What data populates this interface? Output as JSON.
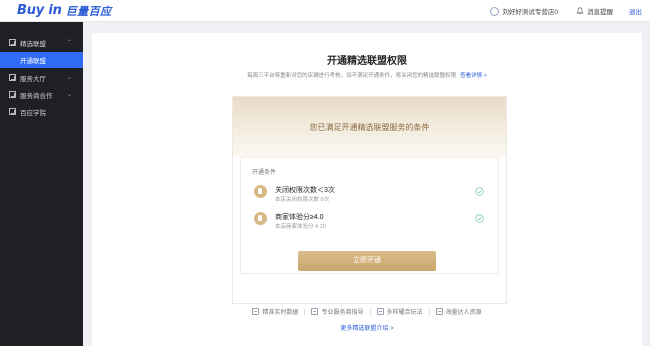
{
  "header": {
    "logo_brand": "Buy in",
    "logo_cn": "巨量百应",
    "shop_name": "刘好好测试专营店0",
    "messages": "消息提醒",
    "logout": "退出"
  },
  "sidebar": {
    "items": [
      {
        "label": "精选联盟",
        "expanded": true,
        "icon": "grid-icon",
        "chevron": "⌃"
      },
      {
        "label": "服务大厅",
        "expanded": false,
        "icon": "grid-icon",
        "chevron": "⌄"
      },
      {
        "label": "服务商合作",
        "expanded": false,
        "icon": "grid-icon",
        "chevron": "⌄"
      },
      {
        "label": "百应学院",
        "expanded": false,
        "icon": "grid-icon",
        "chevron": ""
      }
    ],
    "sub_active": "开通联盟"
  },
  "page": {
    "title": "开通精选联盟权限",
    "subtitle": "每周三平台将重新对您的店铺进行考核，如不满足开通条件，将关闭您的精选联盟权限",
    "subtitle_link": "查看详情 >"
  },
  "card": {
    "banner_text": "您已满足开通精选联盟服务的条件",
    "section_label": "开通条件",
    "conditions": [
      {
        "title": "关闭权限次数＜3次",
        "desc": "本店关闭权限次数 0次",
        "met": true
      },
      {
        "title": "商家体验分≥4.0",
        "desc": "本店商家体验分 4.10",
        "met": true
      }
    ],
    "cta": "立即开通"
  },
  "features": [
    "精准实时数据",
    "专业服务商指导",
    "多样耀合玩法",
    "海量达人资源"
  ],
  "more_link": "更多精选联盟介绍 >",
  "colors": {
    "accent": "#2f6cf6",
    "gold": "#c9a56b",
    "sidebar_bg": "#1f2025"
  }
}
